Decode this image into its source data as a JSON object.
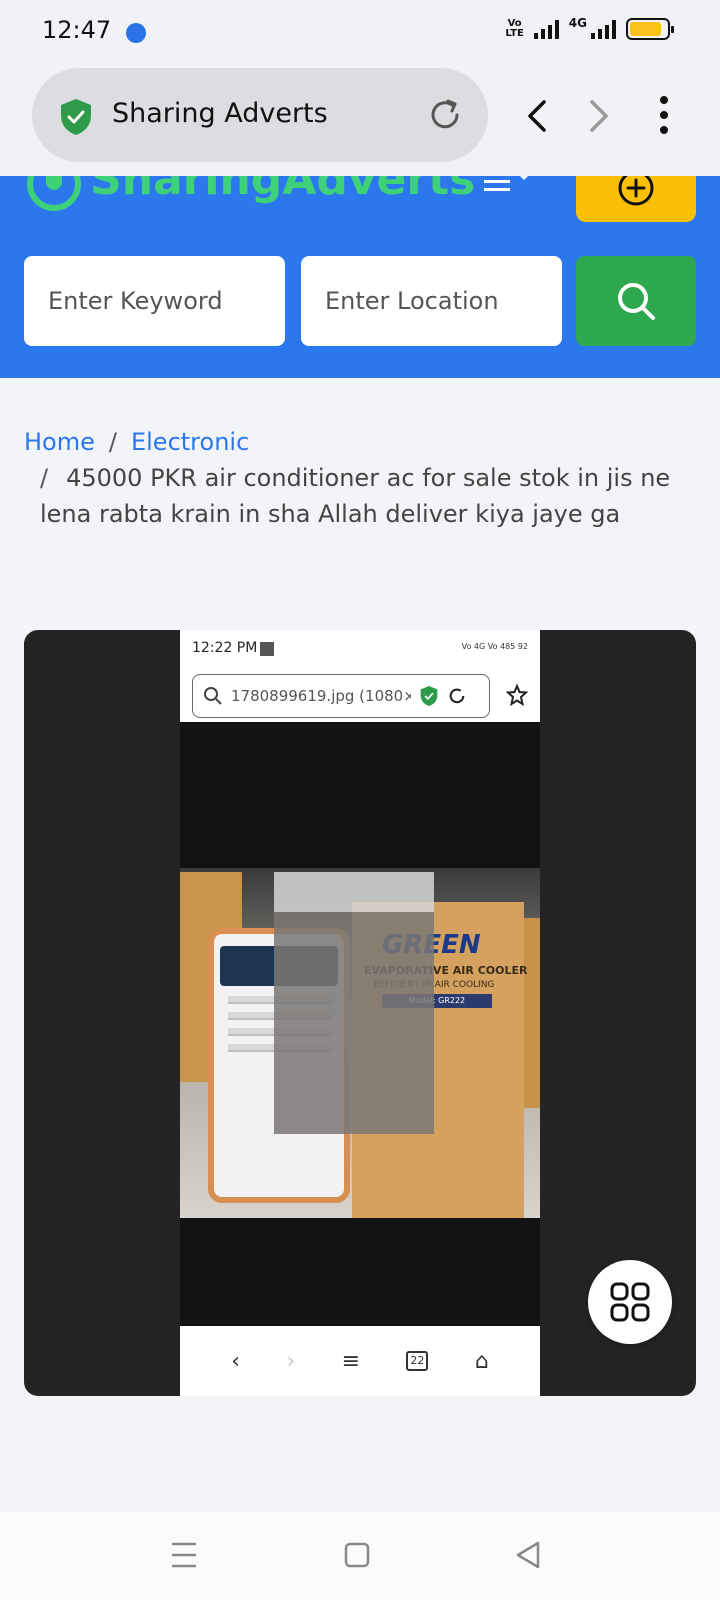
{
  "status_bar": {
    "time": "12:47",
    "volte_top": "Vo",
    "volte_bottom": "LTE",
    "network": "4G",
    "battery_level": 0.85,
    "battery_color": "#f8c21a"
  },
  "browser": {
    "title": "Sharing Adverts",
    "shield_color": "#2e9b4a"
  },
  "header": {
    "logo_text": "SharingAdverts",
    "bg_color": "#2b77ee",
    "keyword_placeholder": "Enter Keyword",
    "location_placeholder": "Enter Location",
    "add_color": "#fbbf08",
    "search_color": "#2da84f"
  },
  "breadcrumb": {
    "home": "Home",
    "separator": "/",
    "category": "Electronic",
    "current": "45000 PKR air conditioner ac for sale stok in jis ne lena rabta krain in sha Allah deliver kiya jaye ga"
  },
  "viewer": {
    "inner_time": "12:22 PM",
    "inner_signal": "Vo 4G Vo 485 92",
    "inner_url": "1780899619.jpg (1080×...",
    "photo": {
      "brand": "GREEN",
      "line1": "EVAPORATIVE AIR COOLER",
      "line2": "EFFICIENT IN AIR COOLING",
      "model": "Model: GR222"
    },
    "inner_tab_count": "22"
  }
}
